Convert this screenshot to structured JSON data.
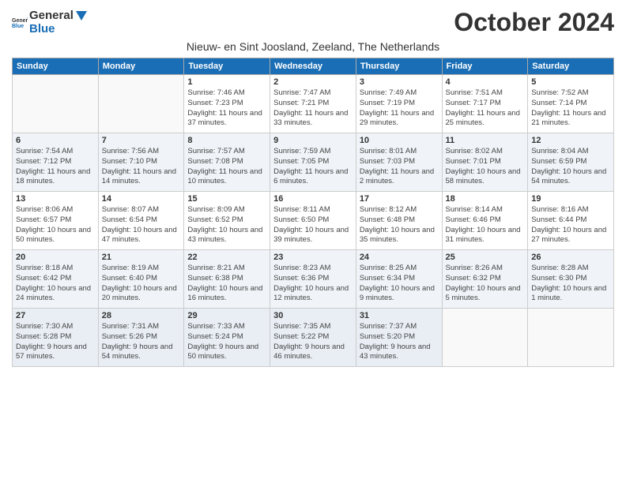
{
  "header": {
    "logo_general": "General",
    "logo_blue": "Blue",
    "title": "October 2024",
    "subtitle": "Nieuw- en Sint Joosland, Zeeland, The Netherlands"
  },
  "weekdays": [
    "Sunday",
    "Monday",
    "Tuesday",
    "Wednesday",
    "Thursday",
    "Friday",
    "Saturday"
  ],
  "weeks": [
    [
      {
        "day": "",
        "info": ""
      },
      {
        "day": "",
        "info": ""
      },
      {
        "day": "1",
        "info": "Sunrise: 7:46 AM\nSunset: 7:23 PM\nDaylight: 11 hours and 37 minutes."
      },
      {
        "day": "2",
        "info": "Sunrise: 7:47 AM\nSunset: 7:21 PM\nDaylight: 11 hours and 33 minutes."
      },
      {
        "day": "3",
        "info": "Sunrise: 7:49 AM\nSunset: 7:19 PM\nDaylight: 11 hours and 29 minutes."
      },
      {
        "day": "4",
        "info": "Sunrise: 7:51 AM\nSunset: 7:17 PM\nDaylight: 11 hours and 25 minutes."
      },
      {
        "day": "5",
        "info": "Sunrise: 7:52 AM\nSunset: 7:14 PM\nDaylight: 11 hours and 21 minutes."
      }
    ],
    [
      {
        "day": "6",
        "info": "Sunrise: 7:54 AM\nSunset: 7:12 PM\nDaylight: 11 hours and 18 minutes."
      },
      {
        "day": "7",
        "info": "Sunrise: 7:56 AM\nSunset: 7:10 PM\nDaylight: 11 hours and 14 minutes."
      },
      {
        "day": "8",
        "info": "Sunrise: 7:57 AM\nSunset: 7:08 PM\nDaylight: 11 hours and 10 minutes."
      },
      {
        "day": "9",
        "info": "Sunrise: 7:59 AM\nSunset: 7:05 PM\nDaylight: 11 hours and 6 minutes."
      },
      {
        "day": "10",
        "info": "Sunrise: 8:01 AM\nSunset: 7:03 PM\nDaylight: 11 hours and 2 minutes."
      },
      {
        "day": "11",
        "info": "Sunrise: 8:02 AM\nSunset: 7:01 PM\nDaylight: 10 hours and 58 minutes."
      },
      {
        "day": "12",
        "info": "Sunrise: 8:04 AM\nSunset: 6:59 PM\nDaylight: 10 hours and 54 minutes."
      }
    ],
    [
      {
        "day": "13",
        "info": "Sunrise: 8:06 AM\nSunset: 6:57 PM\nDaylight: 10 hours and 50 minutes."
      },
      {
        "day": "14",
        "info": "Sunrise: 8:07 AM\nSunset: 6:54 PM\nDaylight: 10 hours and 47 minutes."
      },
      {
        "day": "15",
        "info": "Sunrise: 8:09 AM\nSunset: 6:52 PM\nDaylight: 10 hours and 43 minutes."
      },
      {
        "day": "16",
        "info": "Sunrise: 8:11 AM\nSunset: 6:50 PM\nDaylight: 10 hours and 39 minutes."
      },
      {
        "day": "17",
        "info": "Sunrise: 8:12 AM\nSunset: 6:48 PM\nDaylight: 10 hours and 35 minutes."
      },
      {
        "day": "18",
        "info": "Sunrise: 8:14 AM\nSunset: 6:46 PM\nDaylight: 10 hours and 31 minutes."
      },
      {
        "day": "19",
        "info": "Sunrise: 8:16 AM\nSunset: 6:44 PM\nDaylight: 10 hours and 27 minutes."
      }
    ],
    [
      {
        "day": "20",
        "info": "Sunrise: 8:18 AM\nSunset: 6:42 PM\nDaylight: 10 hours and 24 minutes."
      },
      {
        "day": "21",
        "info": "Sunrise: 8:19 AM\nSunset: 6:40 PM\nDaylight: 10 hours and 20 minutes."
      },
      {
        "day": "22",
        "info": "Sunrise: 8:21 AM\nSunset: 6:38 PM\nDaylight: 10 hours and 16 minutes."
      },
      {
        "day": "23",
        "info": "Sunrise: 8:23 AM\nSunset: 6:36 PM\nDaylight: 10 hours and 12 minutes."
      },
      {
        "day": "24",
        "info": "Sunrise: 8:25 AM\nSunset: 6:34 PM\nDaylight: 10 hours and 9 minutes."
      },
      {
        "day": "25",
        "info": "Sunrise: 8:26 AM\nSunset: 6:32 PM\nDaylight: 10 hours and 5 minutes."
      },
      {
        "day": "26",
        "info": "Sunrise: 8:28 AM\nSunset: 6:30 PM\nDaylight: 10 hours and 1 minute."
      }
    ],
    [
      {
        "day": "27",
        "info": "Sunrise: 7:30 AM\nSunset: 5:28 PM\nDaylight: 9 hours and 57 minutes."
      },
      {
        "day": "28",
        "info": "Sunrise: 7:31 AM\nSunset: 5:26 PM\nDaylight: 9 hours and 54 minutes."
      },
      {
        "day": "29",
        "info": "Sunrise: 7:33 AM\nSunset: 5:24 PM\nDaylight: 9 hours and 50 minutes."
      },
      {
        "day": "30",
        "info": "Sunrise: 7:35 AM\nSunset: 5:22 PM\nDaylight: 9 hours and 46 minutes."
      },
      {
        "day": "31",
        "info": "Sunrise: 7:37 AM\nSunset: 5:20 PM\nDaylight: 9 hours and 43 minutes."
      },
      {
        "day": "",
        "info": ""
      },
      {
        "day": "",
        "info": ""
      }
    ]
  ]
}
